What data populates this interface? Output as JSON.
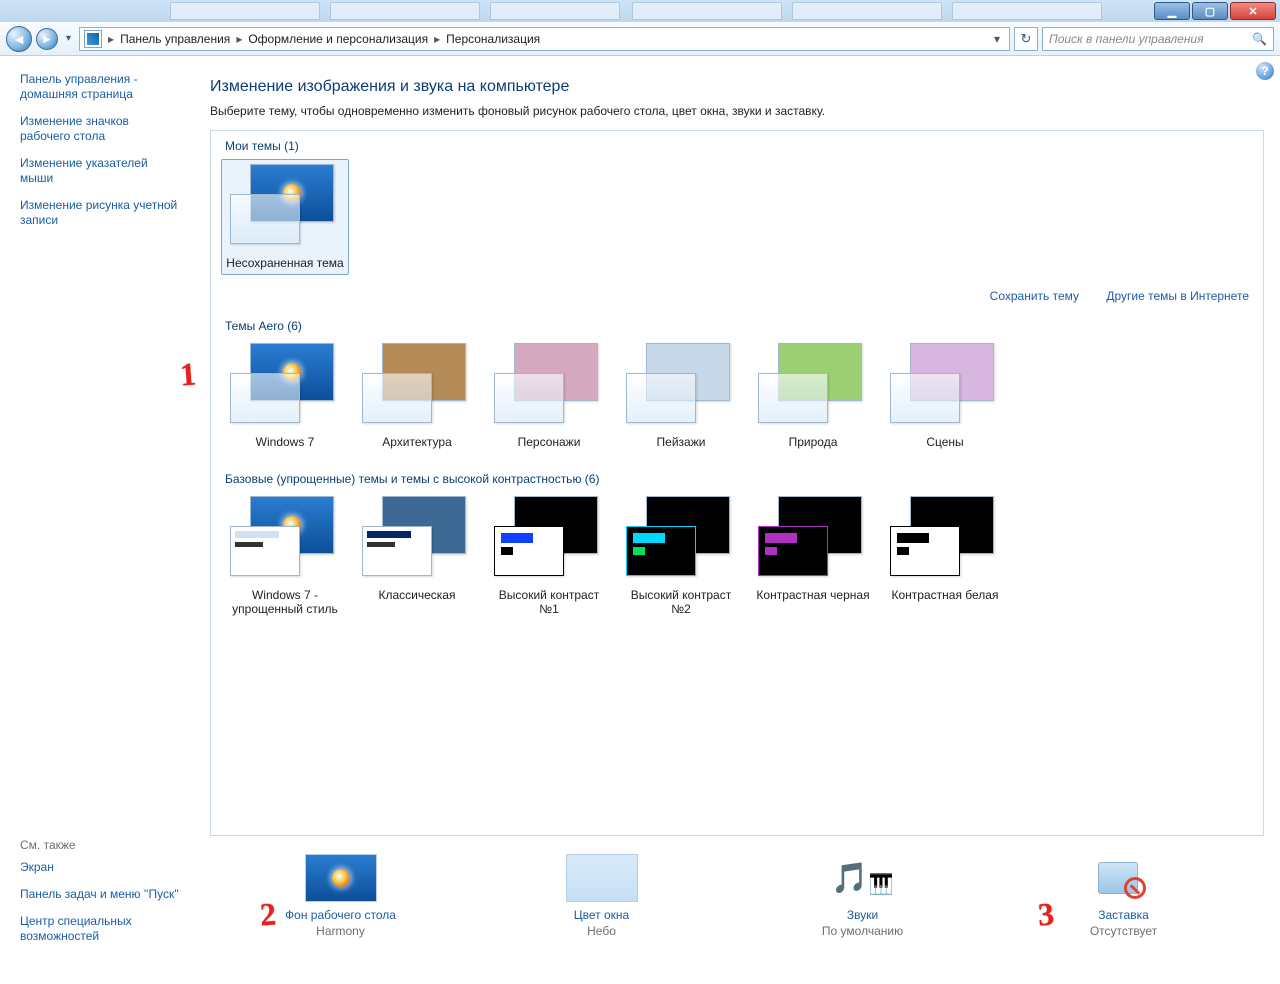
{
  "window_buttons": {
    "min": "▁",
    "max": "▢",
    "close": "✕"
  },
  "breadcrumbs": [
    "Панель управления",
    "Оформление и персонализация",
    "Персонализация"
  ],
  "search_placeholder": "Поиск в панели управления",
  "sidebar": {
    "top": [
      "Панель управления - домашняя страница",
      "Изменение значков рабочего стола",
      "Изменение указателей мыши",
      "Изменение рисунка учетной записи"
    ],
    "seealso_head": "См. также",
    "seealso": [
      "Экран",
      "Панель задач и меню ''Пуск''",
      "Центр специальных возможностей"
    ]
  },
  "page": {
    "title": "Изменение изображения и звука на компьютере",
    "subtitle": "Выберите тему, чтобы одновременно изменить фоновый рисунок рабочего стола, цвет окна, звуки и заставку."
  },
  "sections": {
    "my_themes": {
      "head": "Мои темы (1)",
      "items": [
        "Несохраненная тема"
      ]
    },
    "links": {
      "save": "Сохранить тему",
      "more": "Другие темы в Интернете"
    },
    "aero": {
      "head": "Темы Aero (6)",
      "items": [
        "Windows 7",
        "Архитектура",
        "Персонажи",
        "Пейзажи",
        "Природа",
        "Сцены"
      ]
    },
    "basic": {
      "head": "Базовые (упрощенные) темы и темы с высокой контрастностью (6)",
      "items": [
        "Windows 7 - упрощенный стиль",
        "Классическая",
        "Высокий контраст №1",
        "Высокий контраст №2",
        "Контрастная черная",
        "Контрастная белая"
      ]
    }
  },
  "quick": {
    "desktop_bg": {
      "label": "Фон рабочего стола",
      "value": "Harmony"
    },
    "window_color": {
      "label": "Цвет окна",
      "value": "Небо"
    },
    "sounds": {
      "label": "Звуки",
      "value": "По умолчанию"
    },
    "screensaver": {
      "label": "Заставка",
      "value": "Отсутствует"
    }
  },
  "annotations": {
    "a1": "1",
    "a2": "2",
    "a3": "3"
  },
  "aero_bg_colors": [
    "",
    "#b48a57",
    "#d4a9c0",
    "#c7d8e8",
    "#9ccf74",
    "#d7b6e0"
  ],
  "hc_schemes": [
    {
      "bar1": "#1040ff",
      "bar2": "#000",
      "win": "#000",
      "stackB": "#ffffff",
      "stackBborder": "#000"
    },
    {
      "bar1": "#00d8ff",
      "bar2": "#00e060",
      "win": "#000",
      "stackB": "#000",
      "stackBborder": "#00d8ff"
    },
    {
      "bar1": "#b030c0",
      "bar2": "#b030c0",
      "win": "#000",
      "stackB": "#000",
      "stackBborder": "#b030c0"
    },
    {
      "bar1": "#000",
      "bar2": "#000",
      "win": "#fff",
      "stackB": "#fff",
      "stackBborder": "#000"
    }
  ]
}
